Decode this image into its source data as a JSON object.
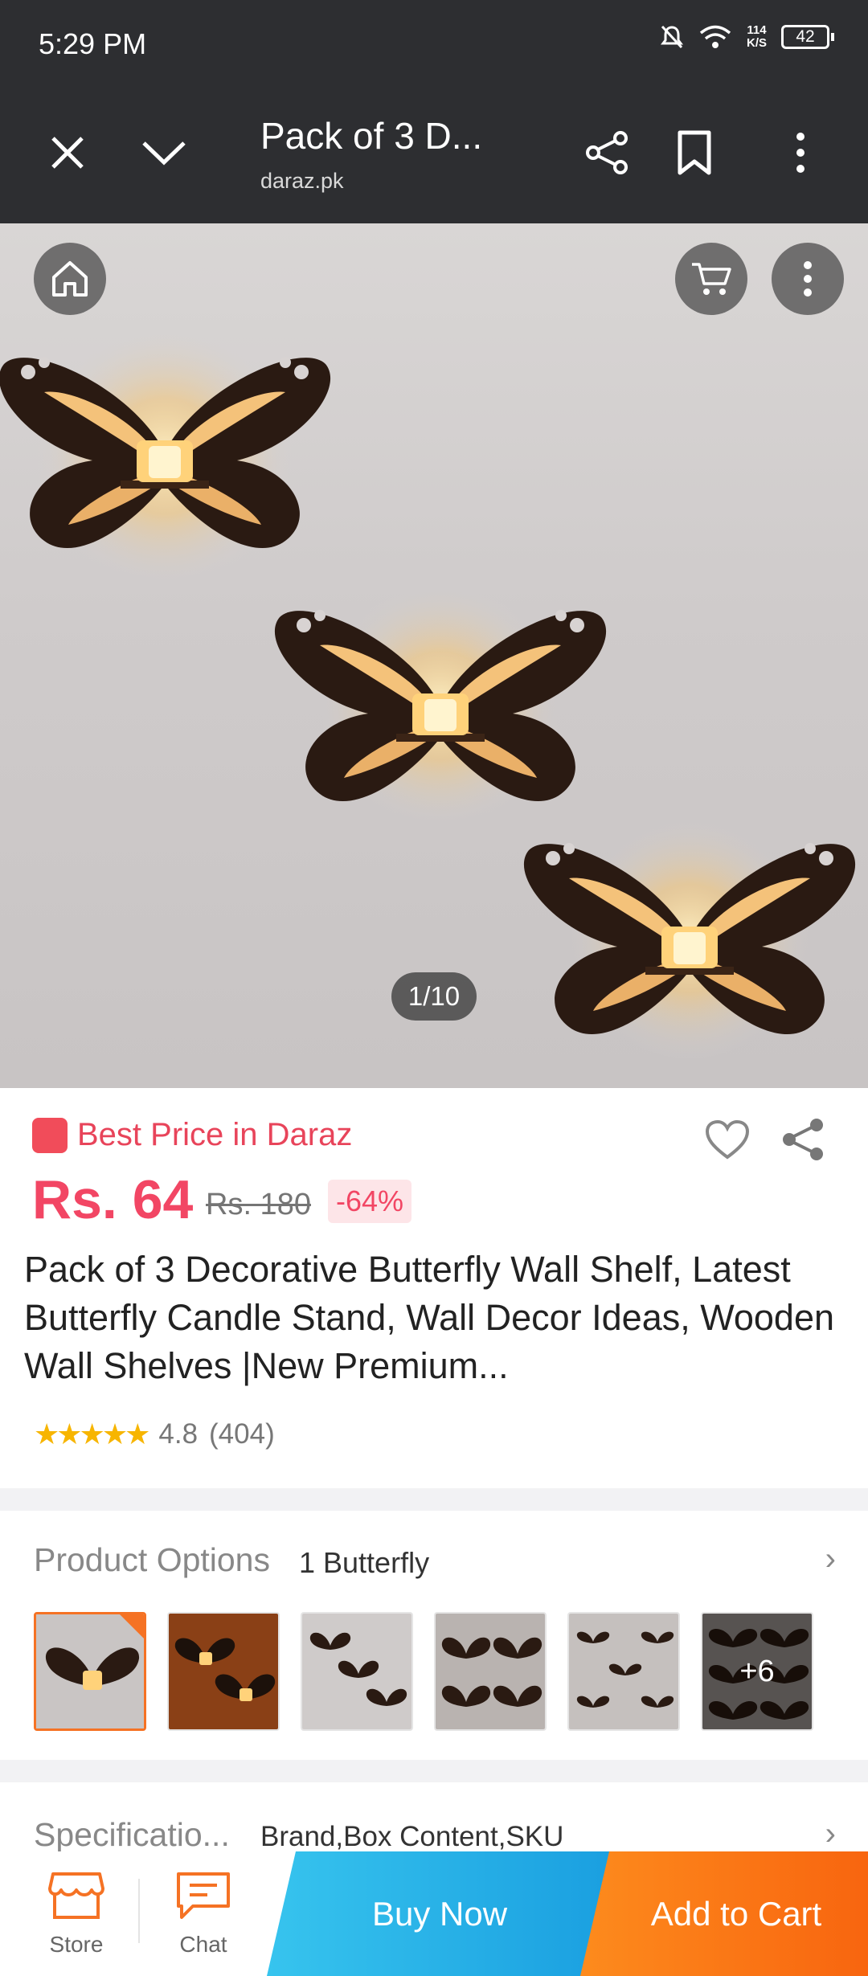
{
  "status_bar": {
    "time": "5:29 PM",
    "speed_top": "114",
    "speed_unit": "K/S",
    "battery": "42"
  },
  "browser": {
    "title": "Pack of 3 D...",
    "domain": "daraz.pk"
  },
  "gallery": {
    "counter": "1/10"
  },
  "product": {
    "badge_text": "Best Price in Daraz",
    "price": "Rs. 64",
    "old_price": "Rs. 180",
    "discount": "-64%",
    "title": "Pack of 3 Decorative Butterfly Wall Shelf, Latest Butterfly Candle Stand, Wall Decor Ideas, Wooden Wall Shelves |New Premium...",
    "rating": "4.8",
    "reviews": "(404)",
    "stars": "★★★★★"
  },
  "options": {
    "label": "Product Options",
    "value": "1 Butterfly",
    "more": "+6"
  },
  "specs": {
    "label": "Specificatio...",
    "value": "Brand,Box Content,SKU"
  },
  "bottom_bar": {
    "store": "Store",
    "chat": "Chat",
    "buy_now": "Buy Now",
    "add_to_cart": "Add to Cart"
  },
  "colors": {
    "price_red": "#f24664",
    "orange": "#f57224",
    "blue": "#1a9fe0"
  }
}
